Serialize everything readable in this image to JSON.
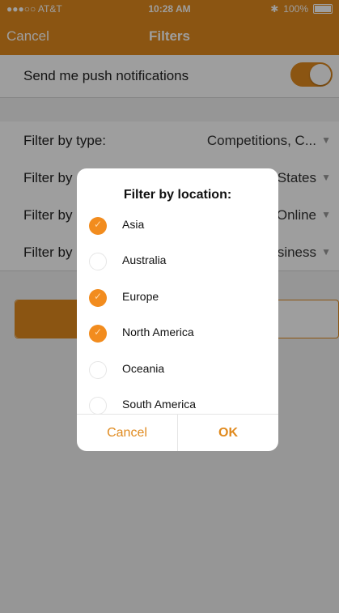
{
  "status": {
    "carrier": "●●●○○ AT&T",
    "wifi_icon": "wifi-icon",
    "time": "10:28 AM",
    "battery": "100%",
    "bluetooth_icon": "bluetooth-icon"
  },
  "nav": {
    "cancel_label": "Cancel",
    "title": "Filters"
  },
  "push": {
    "label": "Send me push notifications",
    "enabled": true
  },
  "filters": [
    {
      "label": "Filter by type:",
      "value": "Competitions, C..."
    },
    {
      "label": "Filter by",
      "value": "States"
    },
    {
      "label": "Filter by",
      "value": "Online"
    },
    {
      "label": "Filter by",
      "value": "usiness"
    }
  ],
  "dialog": {
    "title": "Filter by location:",
    "options": [
      {
        "label": "Asia",
        "checked": true
      },
      {
        "label": "Australia",
        "checked": false
      },
      {
        "label": "Europe",
        "checked": true
      },
      {
        "label": "North America",
        "checked": true
      },
      {
        "label": "Oceania",
        "checked": false
      },
      {
        "label": "South America",
        "checked": false
      }
    ],
    "cancel_label": "Cancel",
    "ok_label": "OK"
  },
  "colors": {
    "accent": "#e08a1e"
  }
}
